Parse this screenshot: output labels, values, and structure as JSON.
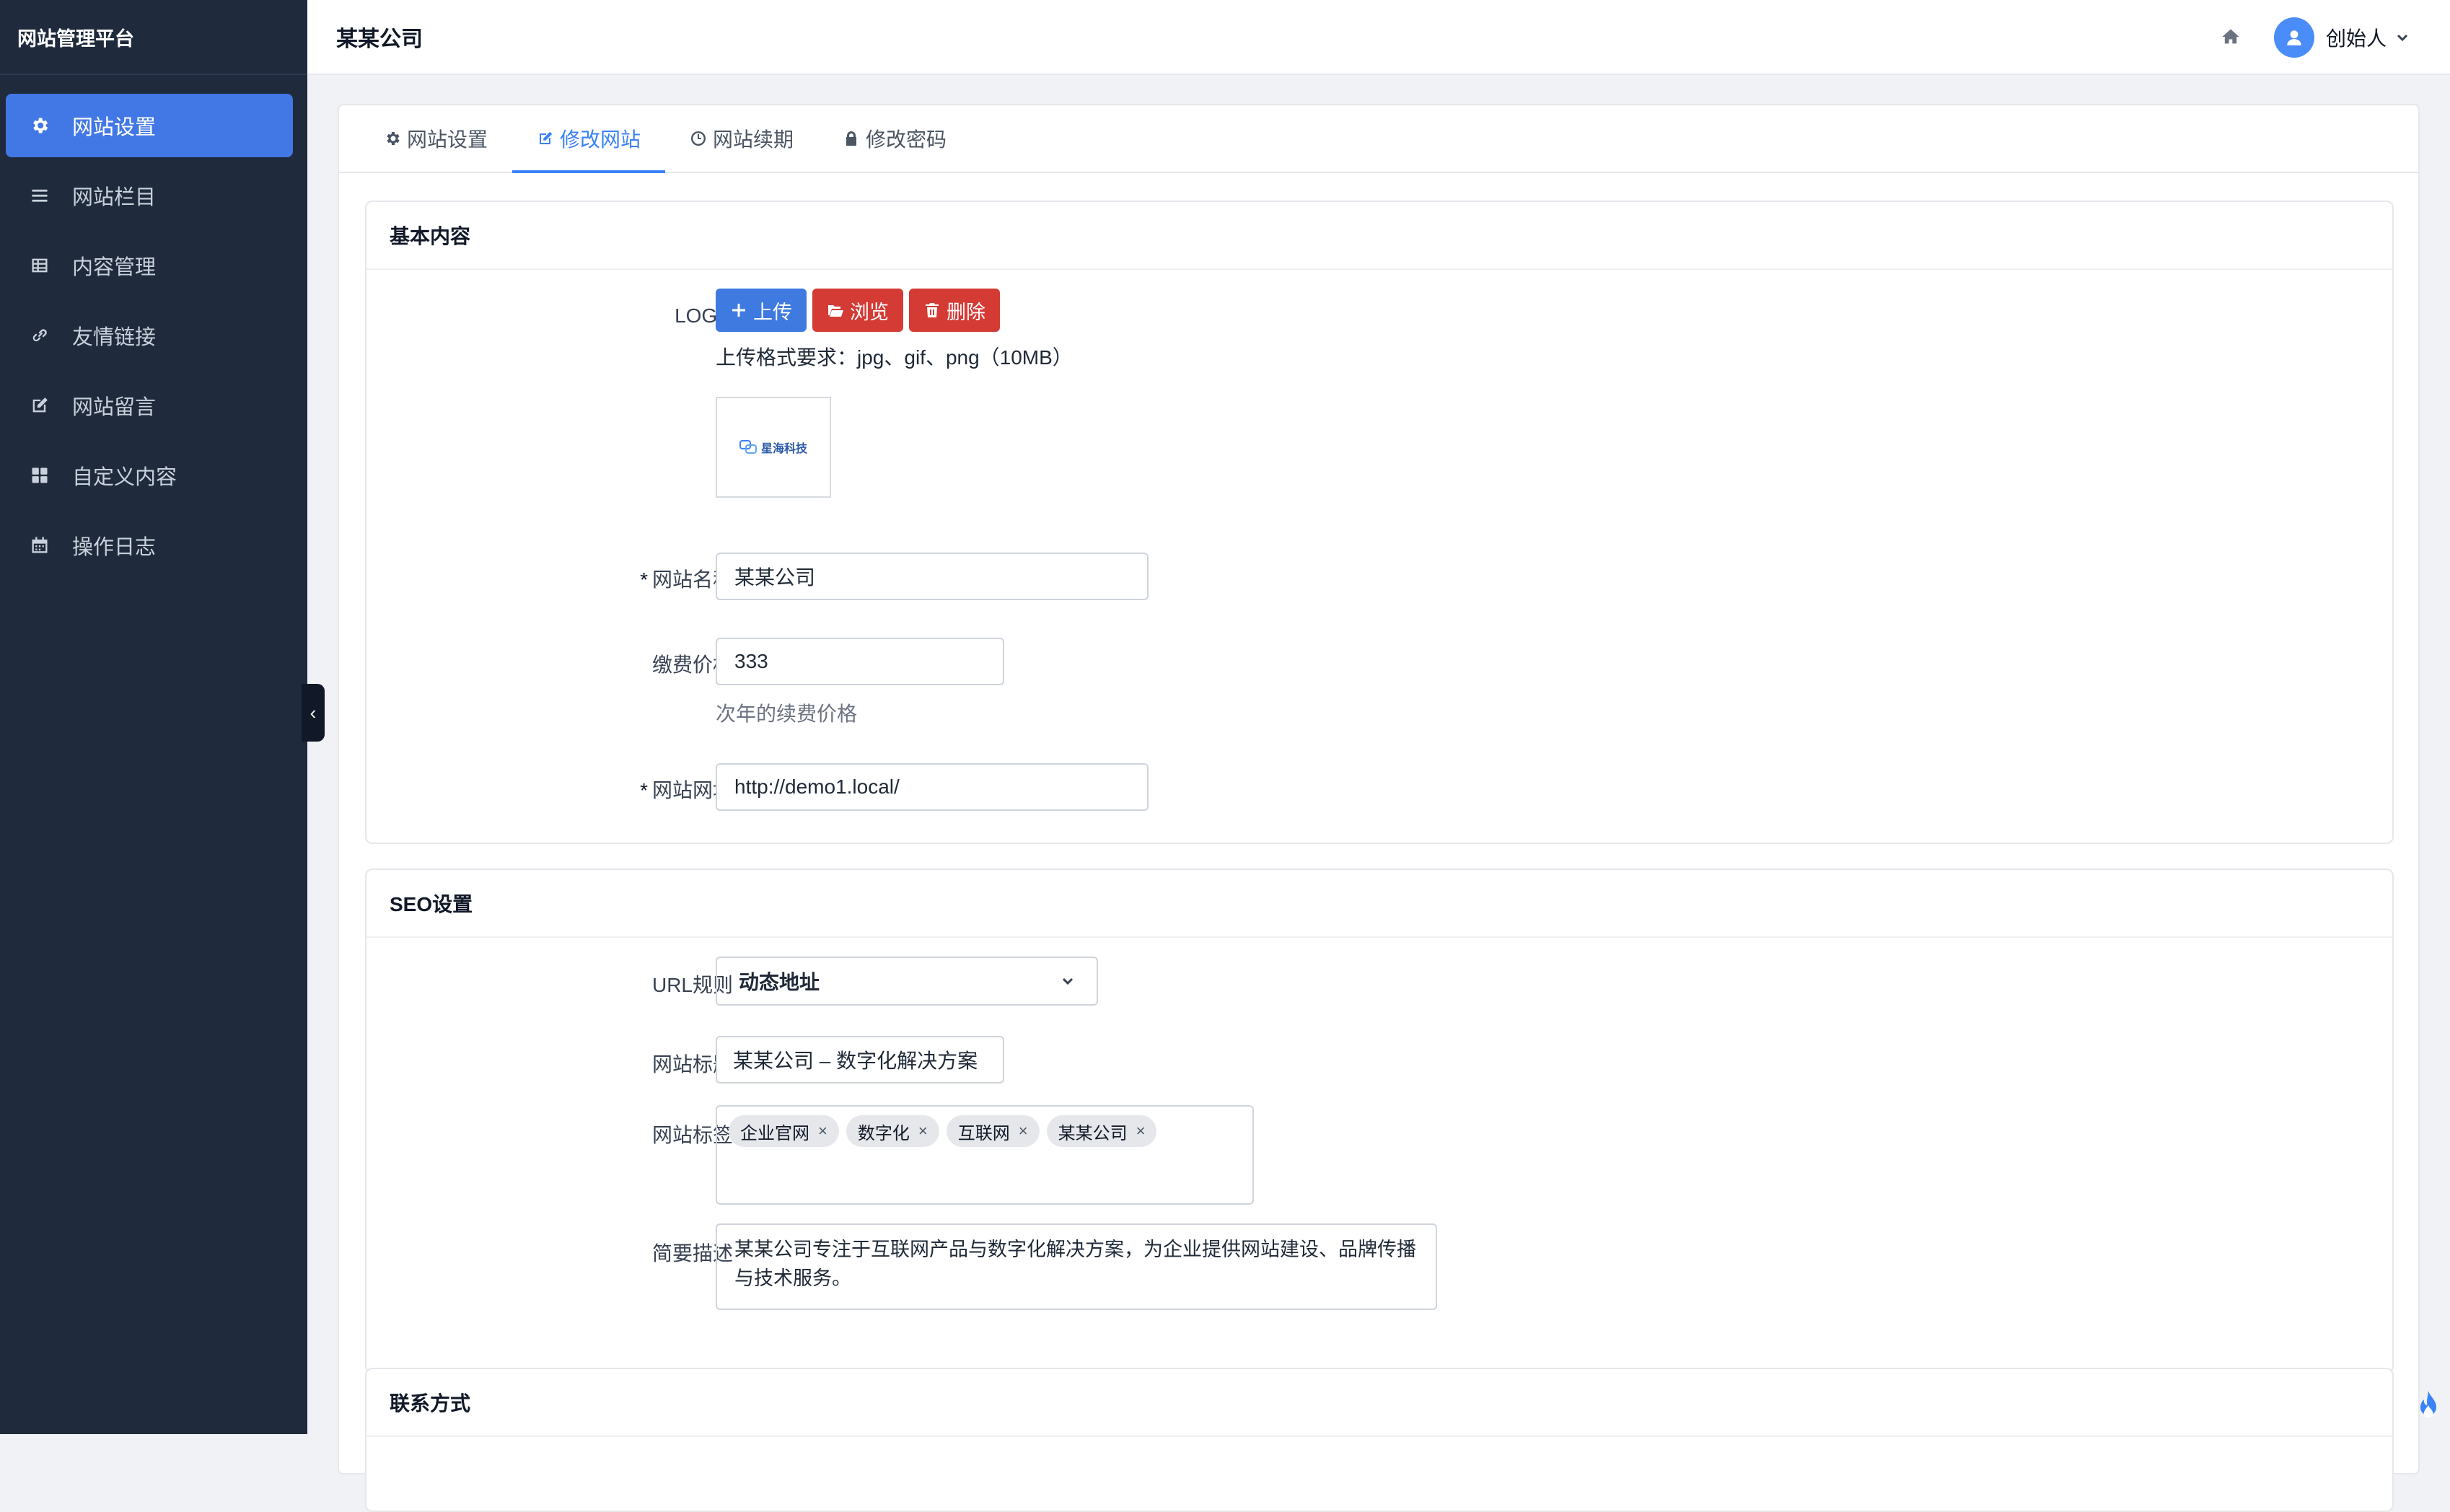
{
  "app": {
    "brand": "网站管理平台"
  },
  "sidebar": {
    "items": [
      {
        "label": "网站设置",
        "icon": "gear-icon",
        "active": true
      },
      {
        "label": "网站栏目",
        "icon": "list-icon"
      },
      {
        "label": "内容管理",
        "icon": "table-icon"
      },
      {
        "label": "友情链接",
        "icon": "link-icon"
      },
      {
        "label": "网站留言",
        "icon": "edit-icon"
      },
      {
        "label": "自定义内容",
        "icon": "grid-icon"
      },
      {
        "label": "操作日志",
        "icon": "calendar-icon"
      }
    ]
  },
  "header": {
    "title": "某某公司",
    "user": "创始人"
  },
  "tabs": [
    {
      "label": "网站设置",
      "icon": "gear-icon"
    },
    {
      "label": "修改网站",
      "icon": "edit-icon",
      "active": true
    },
    {
      "label": "网站续期",
      "icon": "clock-icon"
    },
    {
      "label": "修改密码",
      "icon": "lock-icon"
    }
  ],
  "basic": {
    "heading": "基本内容",
    "logo_label": "LOGO",
    "upload_btn": "上传",
    "browse_btn": "浏览",
    "delete_btn": "删除",
    "upload_hint": "上传格式要求：jpg、gif、png（10MB）",
    "logo_text": "星海科技",
    "required_mark": "*",
    "name_label": "网站名称",
    "name_value": "某某公司",
    "price_label": "缴费价格",
    "price_value": "333",
    "price_help": "次年的续费价格",
    "url_label": "网站网址",
    "url_value": "http://demo1.local/"
  },
  "seo": {
    "heading": "SEO设置",
    "url_rule_label": "URL规则",
    "url_rule_value": "动态地址",
    "title_label": "网站标题",
    "title_value": "某某公司 – 数字化解决方案",
    "tags_label": "网站标签",
    "tags": [
      "企业官网",
      "数字化",
      "互联网",
      "某某公司"
    ],
    "tag_remove": "×",
    "desc_label": "简要描述",
    "desc_value": "某某公司专注于互联网产品与数字化解决方案，为企业提供网站建设、品牌传播与技术服务。"
  },
  "contact": {
    "heading": "联系方式"
  },
  "colors": {
    "sidebar": "#1f2a3c",
    "accent": "#4277e6",
    "danger": "#d43b35"
  }
}
